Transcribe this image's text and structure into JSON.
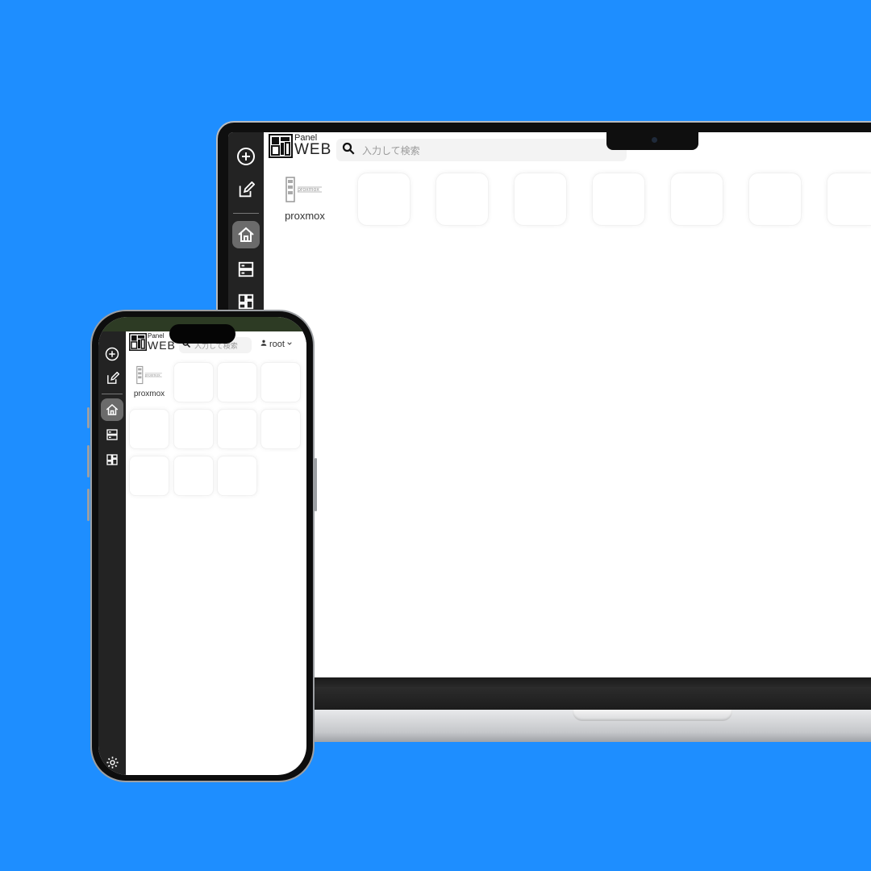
{
  "app": {
    "logo_small": "Panel",
    "logo_large": "WEB",
    "search_placeholder": "入力して検索",
    "user_label": "root"
  },
  "sidebar": {
    "items": [
      {
        "icon": "add-circle-icon",
        "label": "Add"
      },
      {
        "icon": "edit-icon",
        "label": "Edit"
      },
      {
        "icon": "home-icon",
        "label": "Home",
        "active": true
      },
      {
        "icon": "server-icon",
        "label": "Servers"
      },
      {
        "icon": "dashboard-icon",
        "label": "Dashboard"
      }
    ],
    "footer_icon": "settings-icon"
  },
  "apps": [
    {
      "label": "proxmox",
      "icon_text": "proxmox"
    }
  ],
  "colors": {
    "background": "#1e8eff",
    "sidebar": "#232323",
    "active_item": "#6b6b6b"
  }
}
